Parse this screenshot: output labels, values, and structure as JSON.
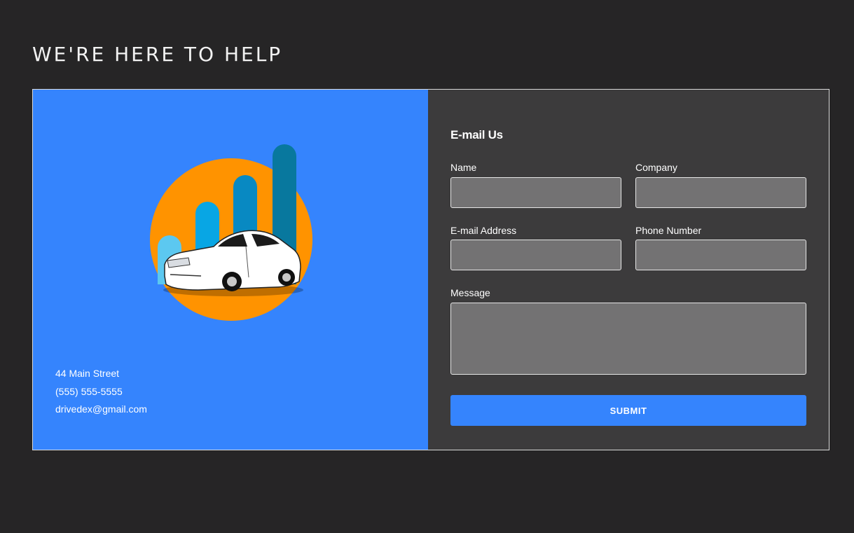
{
  "page": {
    "title": "WE'RE HERE TO HELP"
  },
  "contact": {
    "address": "44 Main Street",
    "phone": "(555) 555-5555",
    "email": "drivedex@gmail.com"
  },
  "form": {
    "heading": "E-mail Us",
    "fields": {
      "name": {
        "label": "Name",
        "value": ""
      },
      "company": {
        "label": "Company",
        "value": ""
      },
      "email": {
        "label": "E-mail Address",
        "value": ""
      },
      "phone": {
        "label": "Phone Number",
        "value": ""
      },
      "message": {
        "label": "Message",
        "value": ""
      }
    },
    "submit_label": "SUBMIT"
  },
  "logo": {
    "icon": "car-growth-chart-logo",
    "colors": {
      "circle": "#ff9300",
      "bar1": "#5cc8f0",
      "bar2": "#08a6e4",
      "bar3": "#0889c2",
      "bar4": "#08789e",
      "car": "#ffffff"
    }
  },
  "colors": {
    "background": "#262526",
    "accent": "#3584fd",
    "form_panel": "#3c3b3c",
    "input_fill": "#737273"
  }
}
